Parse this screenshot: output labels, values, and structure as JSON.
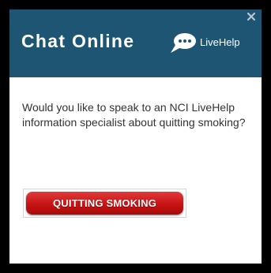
{
  "dialog": {
    "title": "Chat Online",
    "livehelp_label": "LiveHelp",
    "question": "Would you like to speak to an NCI LiveHelp information specialist about quitting smoking?",
    "button_label": "QUITTING SMOKING",
    "close_icon": "close-icon",
    "chat_icon": "chat-bubble-icon"
  },
  "colors": {
    "header_background": "#1d5572",
    "button_red": "#c71313",
    "border_black": "#000000"
  }
}
